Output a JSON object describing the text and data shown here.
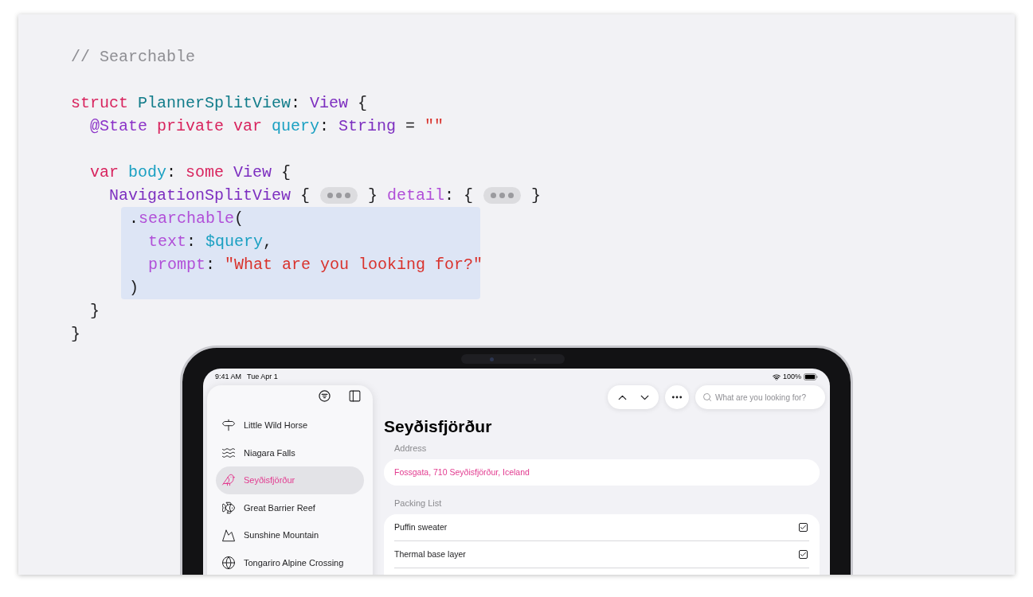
{
  "code": {
    "lines": [
      {
        "kind": "code",
        "highlighted": false,
        "tokens": [
          {
            "kind": "text",
            "text": "// Searchable",
            "color": "#8e8e93"
          }
        ]
      },
      {
        "kind": "blank"
      },
      {
        "kind": "code",
        "highlighted": false,
        "tokens": [
          {
            "kind": "text",
            "text": "struct ",
            "color": "#d8245e"
          },
          {
            "kind": "text",
            "text": "PlannerSplitView",
            "color": "#117c8a"
          },
          {
            "kind": "text",
            "text": ": ",
            "color": "#1d1d1f"
          },
          {
            "kind": "text",
            "text": "View",
            "color": "#7d2fc0"
          },
          {
            "kind": "text",
            "text": " {",
            "color": "#1d1d1f"
          }
        ]
      },
      {
        "kind": "code",
        "highlighted": false,
        "tokens": [
          {
            "kind": "text",
            "text": "  @State",
            "color": "#8c33c8"
          },
          {
            "kind": "text",
            "text": " private var",
            "color": "#d8245e"
          },
          {
            "kind": "text",
            "text": " query",
            "color": "#1aa0c2"
          },
          {
            "kind": "text",
            "text": ": ",
            "color": "#1d1d1f"
          },
          {
            "kind": "text",
            "text": "String",
            "color": "#7d2fc0"
          },
          {
            "kind": "text",
            "text": " = ",
            "color": "#1d1d1f"
          },
          {
            "kind": "text",
            "text": "\"\"",
            "color": "#d9322c"
          }
        ]
      },
      {
        "kind": "blank"
      },
      {
        "kind": "code",
        "highlighted": false,
        "tokens": [
          {
            "kind": "text",
            "text": "  var",
            "color": "#d8245e"
          },
          {
            "kind": "text",
            "text": " body",
            "color": "#1aa0c2"
          },
          {
            "kind": "text",
            "text": ": ",
            "color": "#1d1d1f"
          },
          {
            "kind": "text",
            "text": "some",
            "color": "#d8245e"
          },
          {
            "kind": "text",
            "text": " View",
            "color": "#7d2fc0"
          },
          {
            "kind": "text",
            "text": " {",
            "color": "#1d1d1f"
          }
        ]
      },
      {
        "kind": "code",
        "highlighted": false,
        "tokens": [
          {
            "kind": "text",
            "text": "    NavigationSplitView",
            "color": "#7d2fc0"
          },
          {
            "kind": "text",
            "text": " { ",
            "color": "#1d1d1f"
          },
          {
            "kind": "fold"
          },
          {
            "kind": "text",
            "text": " } ",
            "color": "#1d1d1f"
          },
          {
            "kind": "text",
            "text": "detail",
            "color": "#b14fd8"
          },
          {
            "kind": "text",
            "text": ": { ",
            "color": "#1d1d1f"
          },
          {
            "kind": "fold"
          },
          {
            "kind": "text",
            "text": " }",
            "color": "#1d1d1f"
          }
        ]
      },
      {
        "kind": "code",
        "highlighted": true,
        "tokens": [
          {
            "kind": "text",
            "text": ".",
            "color": "#1d1d1f"
          },
          {
            "kind": "text",
            "text": "searchable",
            "color": "#b14fd8"
          },
          {
            "kind": "text",
            "text": "(",
            "color": "#1d1d1f"
          }
        ]
      },
      {
        "kind": "code",
        "highlighted": true,
        "tokens": [
          {
            "kind": "text",
            "text": "  text",
            "color": "#b14fd8"
          },
          {
            "kind": "text",
            "text": ": ",
            "color": "#1d1d1f"
          },
          {
            "kind": "text",
            "text": "$query",
            "color": "#1aa0c2"
          },
          {
            "kind": "text",
            "text": ",",
            "color": "#1d1d1f"
          }
        ]
      },
      {
        "kind": "code",
        "highlighted": true,
        "tokens": [
          {
            "kind": "text",
            "text": "  prompt",
            "color": "#b14fd8"
          },
          {
            "kind": "text",
            "text": ": ",
            "color": "#1d1d1f"
          },
          {
            "kind": "text",
            "text": "\"What are you looking for?\"",
            "color": "#d9322c"
          }
        ]
      },
      {
        "kind": "code",
        "highlighted": true,
        "tokens": [
          {
            "kind": "text",
            "text": ")",
            "color": "#1d1d1f"
          }
        ]
      },
      {
        "kind": "code",
        "highlighted": false,
        "tokens": [
          {
            "kind": "text",
            "text": "  }",
            "color": "#1d1d1f"
          }
        ]
      },
      {
        "kind": "code",
        "highlighted": false,
        "tokens": [
          {
            "kind": "text",
            "text": "}",
            "color": "#1d1d1f"
          }
        ]
      }
    ]
  },
  "ipad": {
    "status_bar": {
      "time": "9:41 AM",
      "date": "Tue Apr 1",
      "battery": "100%"
    },
    "sidebar": {
      "items": [
        {
          "label": "Little Wild Horse",
          "selected": false
        },
        {
          "label": "Niagara Falls",
          "selected": false
        },
        {
          "label": "Seyðisfjörður",
          "selected": true
        },
        {
          "label": "Great Barrier Reef",
          "selected": false
        },
        {
          "label": "Sunshine Mountain",
          "selected": false
        },
        {
          "label": "Tongariro Alpine Crossing",
          "selected": false
        }
      ]
    },
    "toolbar": {
      "search": {
        "placeholder": "What are you looking for?"
      }
    },
    "detail": {
      "title": "Seyðisfjörður",
      "sections": [
        {
          "header": "Address",
          "kind": "address",
          "rows": [
            {
              "text": "Fossgata, 710 Seyðisfjörður, Iceland"
            }
          ]
        },
        {
          "header": "Packing List",
          "kind": "checklist",
          "rows": [
            {
              "text": "Puffin sweater",
              "checked": true
            },
            {
              "text": "Thermal base layer",
              "checked": true
            }
          ]
        }
      ]
    }
  }
}
